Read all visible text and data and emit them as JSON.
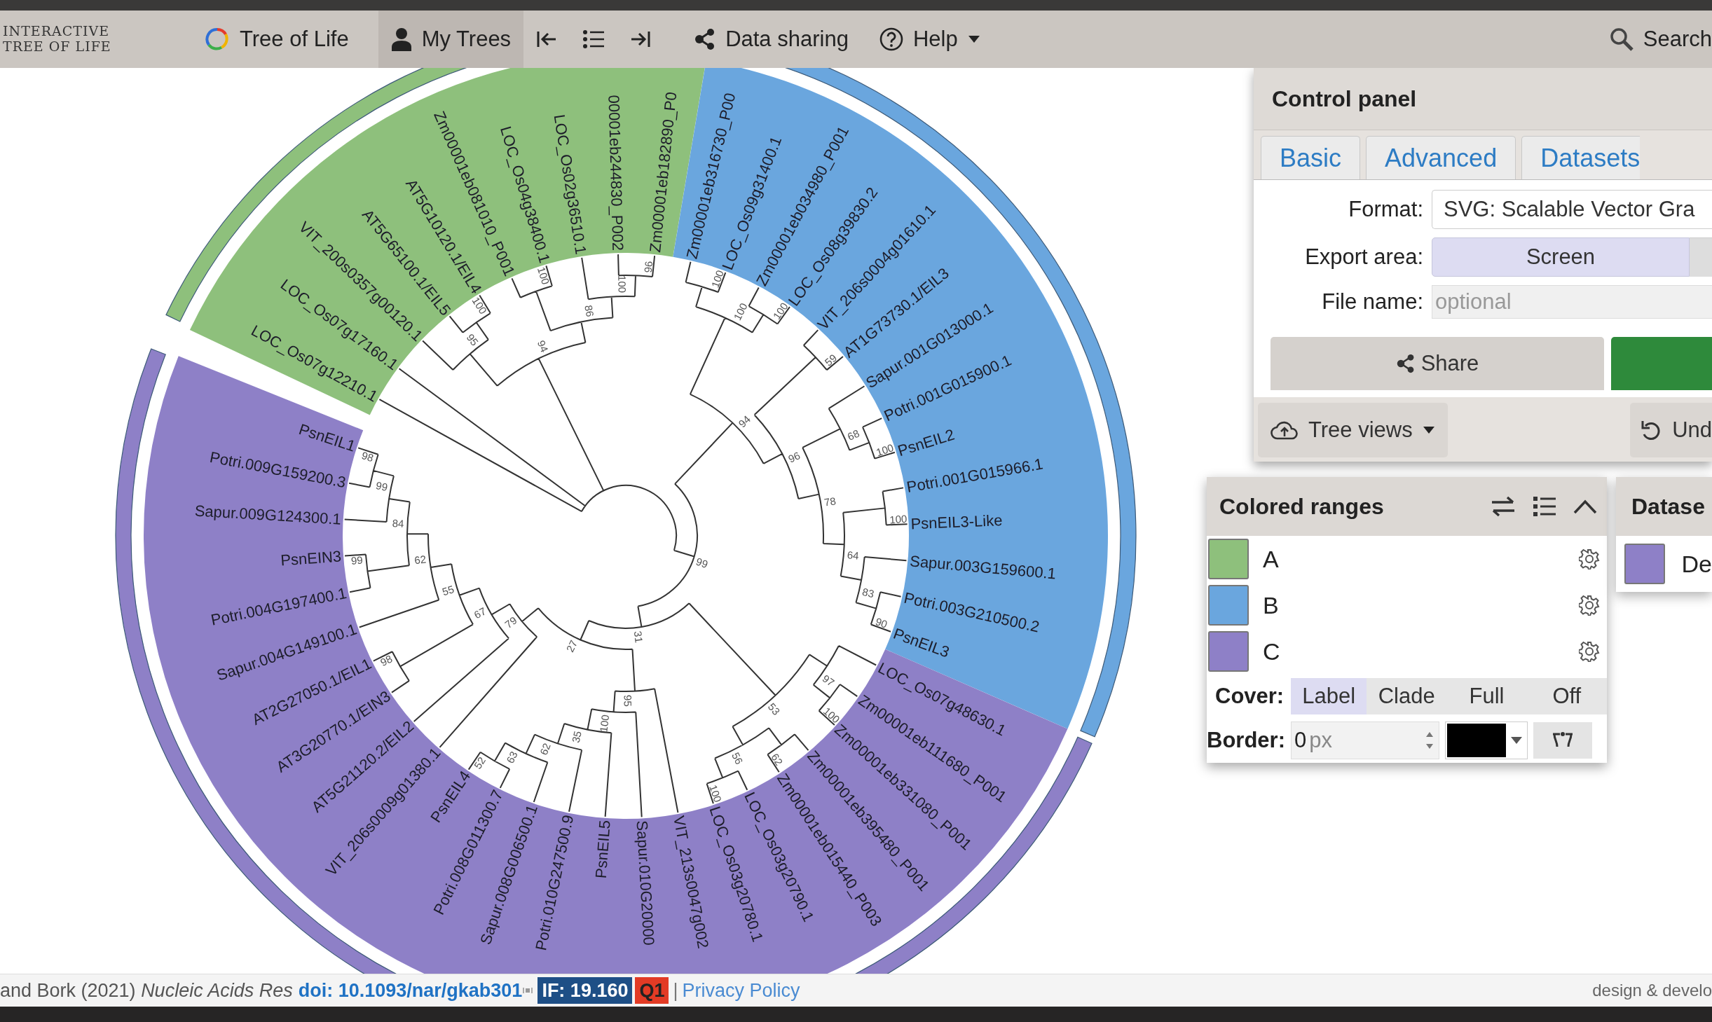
{
  "header": {
    "logo": [
      "INTERACTIVE",
      "TREE OF LIFE"
    ],
    "nav": [
      {
        "kind": "brand",
        "label": "Tree of Life",
        "selected": false,
        "dropdown": false
      },
      {
        "kind": "account",
        "label": "My Trees",
        "selected": true,
        "dropdown": false
      },
      {
        "kind": "first",
        "selected": false,
        "dropdown": false
      },
      {
        "kind": "outline",
        "selected": false,
        "dropdown": false
      },
      {
        "kind": "last",
        "selected": false,
        "dropdown": false
      },
      {
        "kind": "sharing",
        "label": "Data sharing",
        "selected": false,
        "dropdown": false
      },
      {
        "kind": "help",
        "label": "Help",
        "selected": false,
        "dropdown": true
      }
    ],
    "search": {
      "label": "Search"
    }
  },
  "tree": {
    "root": {
      "children": [
        {
          "label": "LOC_Os07g12210.1",
          "color": "#8ec07c"
        },
        {
          "label": "LOC_Os07g17160.1",
          "color": "#8ec07c"
        },
        {
          "support": "94",
          "color": "#8ec07c",
          "children": [
            {
              "support": "95",
              "children": [
                {
                  "label": "VIT_200s0357g00120.1"
                },
                {
                  "support": "100",
                  "children": [
                    {
                      "label": "AT5G65100.1/EIL5"
                    },
                    {
                      "label": "AT5G10120.1/EIL4"
                    }
                  ]
                }
              ]
            },
            {
              "support": "86",
              "children": [
                {
                  "support": "100",
                  "children": [
                    {
                      "label": "Zm00001eb081010_P001"
                    },
                    {
                      "label": "LOC_Os04g38400.1"
                    }
                  ]
                },
                {
                  "support": "100",
                  "children": [
                    {
                      "label": "LOC_Os02g36510.1"
                    },
                    {
                      "support": "96",
                      "children": [
                        {
                          "label": "00001eb244830_P002"
                        },
                        {
                          "label": "Zm00001eb182890_P0"
                        }
                      ]
                    }
                  ]
                }
              ]
            }
          ]
        },
        {
          "support": "99",
          "children": [
            {
              "support": "94",
              "color": "#6aa6de",
              "children": [
                {
                  "support": "100",
                  "children": [
                    {
                      "support": "100",
                      "children": [
                        {
                          "label": "Zm00001eb316730_P00"
                        },
                        {
                          "label": "LOC_Os09g31400.1"
                        }
                      ]
                    },
                    {
                      "support": "100",
                      "children": [
                        {
                          "label": "Zm00001eb034980_P001"
                        },
                        {
                          "label": "LOC_Os08g39830.2"
                        }
                      ]
                    }
                  ]
                },
                {
                  "support": "96",
                  "children": [
                    {
                      "support": "59",
                      "children": [
                        {
                          "label": "VIT_206s0004g01610.1"
                        },
                        {
                          "label": "AT1G73730.1/EIL3"
                        }
                      ]
                    },
                    {
                      "support": "78",
                      "children": [
                        {
                          "support": "68",
                          "children": [
                            {
                              "label": "Sapur.001G013000.1"
                            },
                            {
                              "support": "100",
                              "children": [
                                {
                                  "label": "Potri.001G015900.1"
                                },
                                {
                                  "label": "PsnEIL2"
                                }
                              ]
                            }
                          ]
                        },
                        {
                          "support": "64",
                          "children": [
                            {
                              "support": "100",
                              "children": [
                                {
                                  "label": "Potri.001G015966.1"
                                },
                                {
                                  "label": "PsnEIL3-Like"
                                }
                              ]
                            },
                            {
                              "support": "83",
                              "children": [
                                {
                                  "label": "Sapur.003G159600.1"
                                },
                                {
                                  "support": "90",
                                  "children": [
                                    {
                                      "label": "Potri.003G210500.2"
                                    },
                                    {
                                      "label": "PsnEIL3"
                                    }
                                  ]
                                }
                              ]
                            }
                          ]
                        }
                      ]
                    }
                  ]
                }
              ]
            },
            {
              "support": "31",
              "color": "#8e80c7",
              "children": [
                {
                  "support": "53",
                  "children": [
                    {
                      "support": "97",
                      "children": [
                        {
                          "label": "LOC_Os07g48630.1"
                        },
                        {
                          "support": "100",
                          "children": [
                            {
                              "label": "Zm00001eb111680_P001"
                            },
                            {
                              "label": "Zm00001eb331080_P001"
                            }
                          ]
                        }
                      ]
                    },
                    {
                      "support": "56",
                      "children": [
                        {
                          "support": "62",
                          "children": [
                            {
                              "label": "Zm00001eb395480_P001"
                            },
                            {
                              "label": "Zm00001eb015440_P003"
                            }
                          ]
                        },
                        {
                          "support": "100",
                          "children": [
                            {
                              "label": "LOC_Os03g20790.1"
                            },
                            {
                              "label": "LOC_Os03g20780.1"
                            }
                          ]
                        }
                      ]
                    }
                  ]
                },
                {
                  "support": "27",
                  "children": [
                    {
                      "support": "95",
                      "children": [
                        {
                          "label": "VIT_213s0047g002"
                        },
                        {
                          "support": "100",
                          "children": [
                            {
                              "label": "Sapur.010G20000"
                            },
                            {
                              "support": "35",
                              "children": [
                                {
                                  "label": "PsnEIL5"
                                },
                                {
                                  "support": "62",
                                  "children": [
                                    {
                                      "label": "Potri.010G247500.9"
                                    },
                                    {
                                      "support": "63",
                                      "children": [
                                        {
                                          "label": "Sapur.008G006500.1"
                                        },
                                        {
                                          "support": "52",
                                          "children": [
                                            {
                                              "label": "Potri.008G011300.7"
                                            },
                                            {
                                              "label": "PsnEIL4"
                                            }
                                          ]
                                        }
                                      ]
                                    }
                                  ]
                                }
                              ]
                            }
                          ]
                        }
                      ]
                    },
                    {
                      "support": "79",
                      "children": [
                        {
                          "label": "VIT_206s0009g01380.1"
                        },
                        {
                          "support": "67",
                          "children": [
                            {
                              "label": "AT5G21120.2/EIL2"
                            },
                            {
                              "support": "55",
                              "children": [
                                {
                                  "support": "98",
                                  "children": [
                                    {
                                      "label": "AT3G20770.1/EIN3"
                                    },
                                    {
                                      "label": "AT2G27050.1/EIL1"
                                    }
                                  ]
                                },
                                {
                                  "support": "62",
                                  "children": [
                                    {
                                      "label": "Sapur.004G149100.1"
                                    },
                                    {
                                      "support": "84",
                                      "children": [
                                        {
                                          "support": "99",
                                          "children": [
                                            {
                                              "label": "Potri.004G197400.1"
                                            },
                                            {
                                              "label": "PsnEIN3"
                                            }
                                          ]
                                        },
                                        {
                                          "support": "99",
                                          "children": [
                                            {
                                              "label": "Sapur.009G124300.1"
                                            },
                                            {
                                              "support": "98",
                                              "children": [
                                                {
                                                  "label": "Potri.009G159200.3"
                                                },
                                                {
                                                  "label": "PsnEIL1"
                                                }
                                              ]
                                            }
                                          ]
                                        }
                                      ]
                                    }
                                  ]
                                }
                              ]
                            }
                          ]
                        }
                      ]
                    }
                  ]
                }
              ]
            }
          ]
        }
      ]
    }
  },
  "control_panel": {
    "title": "Control panel",
    "tabs": [
      {
        "label": "Basic",
        "selected": false
      },
      {
        "label": "Advanced",
        "selected": false
      },
      {
        "label": "Datasets",
        "selected": false
      }
    ],
    "fields": [
      {
        "kind": "select",
        "label": "Format:",
        "value": "SVG: Scalable Vector Gra"
      },
      {
        "kind": "segmented",
        "label": "Export area:",
        "options": [
          {
            "label": "Screen",
            "selected": true
          }
        ]
      },
      {
        "kind": "text",
        "label": "File name:",
        "placeholder": "optional"
      }
    ],
    "actions": [
      {
        "kind": "share",
        "label": "Share"
      },
      {
        "kind": "primary"
      }
    ],
    "tools": [
      {
        "kind": "views",
        "label": "Tree views"
      },
      {
        "kind": "undo",
        "label": "Und"
      }
    ]
  },
  "colored_ranges": {
    "title": "Colored ranges",
    "items": [
      {
        "label": "A",
        "color": "#8ec07c"
      },
      {
        "label": "B",
        "color": "#6aa6de"
      },
      {
        "label": "C",
        "color": "#8e80c7"
      }
    ],
    "cover": {
      "label": "Cover:",
      "options": [
        {
          "label": "Label",
          "selected": true
        },
        {
          "label": "Clade",
          "selected": false
        },
        {
          "label": "Full",
          "selected": false
        },
        {
          "label": "Off",
          "selected": false
        }
      ]
    },
    "border": {
      "label": "Border:",
      "value": "0",
      "unit": "px",
      "color": "#000000"
    }
  },
  "datasets": {
    "title": "Datase",
    "items": [
      {
        "label": "De",
        "color": "#8e80c7"
      }
    ]
  },
  "footer": {
    "citation": "and Bork (2021) *Nucleic Acids Res*",
    "doi": "doi: 10.1093/nar/gkab301",
    "impact": "IF: 19.160",
    "quartile": "Q1",
    "separator": "|",
    "privacy": "Privacy Policy",
    "credit": "design & develo"
  }
}
